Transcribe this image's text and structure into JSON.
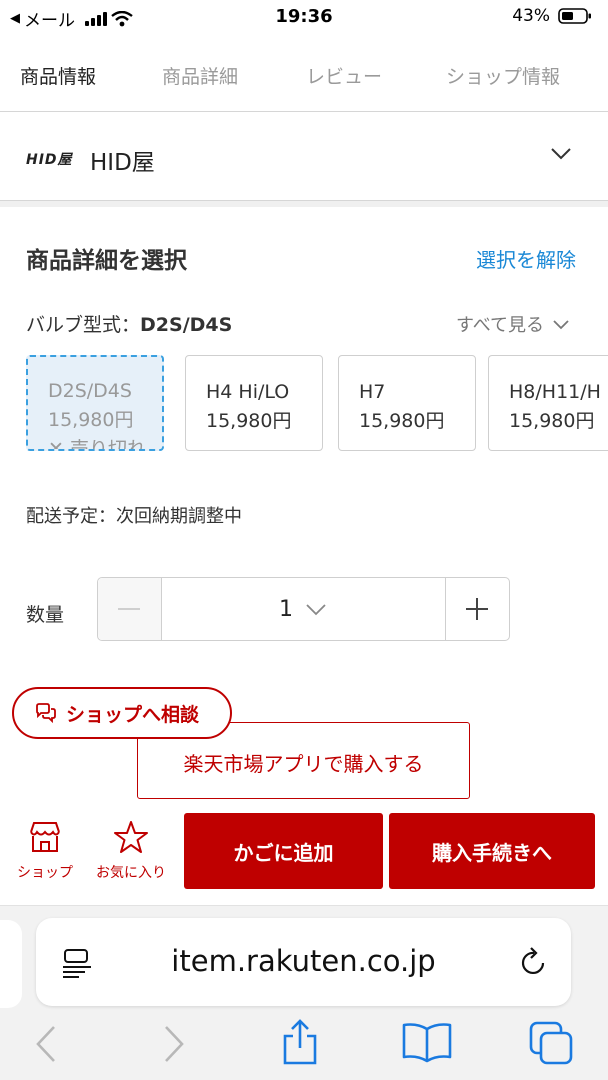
{
  "status_bar": {
    "carrier": "メール",
    "time": "19:36",
    "battery": "43%"
  },
  "tabs": [
    {
      "label": "商品情報",
      "active": true
    },
    {
      "label": "商品詳細",
      "active": false
    },
    {
      "label": "レビュー",
      "active": false
    },
    {
      "label": "ショップ情報",
      "active": false
    }
  ],
  "shop": {
    "logo_text": "HID屋",
    "name": "HID屋"
  },
  "selection": {
    "title": "商品詳細を選択",
    "clear": "選択を解除",
    "bulb_label": "バルブ型式：",
    "bulb_value": "D2S/D4S",
    "see_all": "すべて見る",
    "options": [
      {
        "name": "D2S/D4S",
        "price": "15,980円",
        "status": "✕ 売り切れ"
      },
      {
        "name": "H4 Hi/LO",
        "price": "15,980円"
      },
      {
        "name": "H7",
        "price": "15,980円"
      },
      {
        "name": "H8/H11/H",
        "price": "15,980円"
      }
    ],
    "delivery": "配送予定：次回納期調整中"
  },
  "quantity": {
    "label": "数量",
    "value": "1"
  },
  "consult": "ショップへ相談",
  "app_button": "楽天市場アプリで購入する",
  "actions": {
    "shop": "ショップ",
    "favorite": "お気に入り",
    "cart": "かごに追加",
    "buy": "購入手続きへ"
  },
  "browser": {
    "url": "item.rakuten.co.jp"
  },
  "colors": {
    "brand_red": "#bf0000",
    "link_blue": "#1a88d6",
    "selected_bg": "#e6f0f9"
  }
}
